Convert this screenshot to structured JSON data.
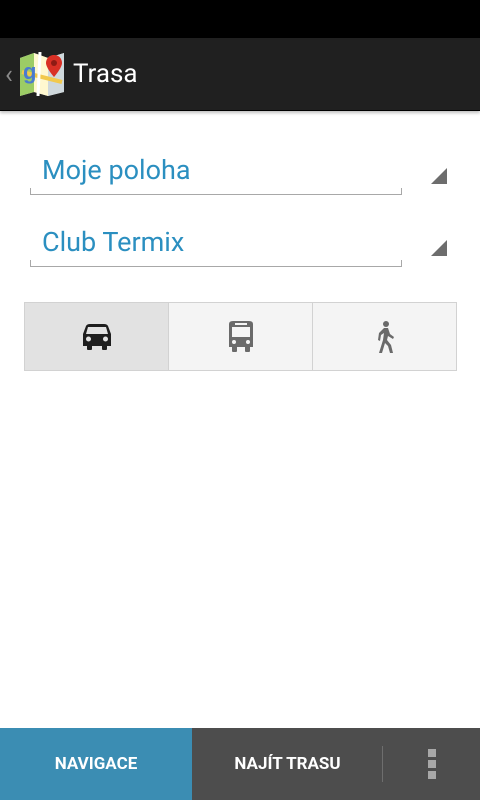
{
  "action_bar": {
    "title": "Trasa",
    "up_caret": "‹",
    "app_icon": "google-maps-icon"
  },
  "route": {
    "origin": "Moje poloha",
    "destination": "Club Termix"
  },
  "travel_modes": [
    {
      "name": "car",
      "icon": "car-icon",
      "selected": true
    },
    {
      "name": "transit",
      "icon": "bus-icon",
      "selected": false
    },
    {
      "name": "walking",
      "icon": "walking-icon",
      "selected": false
    }
  ],
  "bottom_bar": {
    "navigate_label": "NAVIGACE",
    "find_route_label": "NAJÍT TRASU",
    "overflow_icon": "overflow-menu-icon"
  },
  "colors": {
    "accent": "#2b8fc0",
    "navigate_bg": "#3b8db3",
    "bottom_bar_bg": "#4d4d4d",
    "action_bar_bg": "#202020"
  }
}
